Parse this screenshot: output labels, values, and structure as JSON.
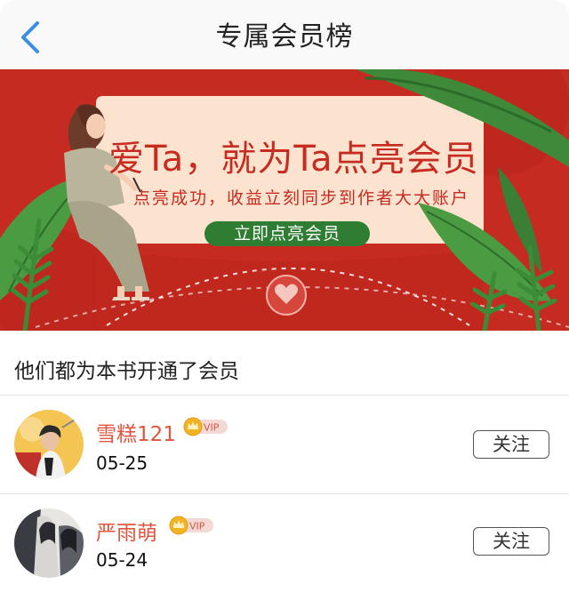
{
  "header": {
    "title": "专属会员榜",
    "back_icon": "chevron-left-icon",
    "accent_color": "#3a8ee6"
  },
  "banner": {
    "headline": "爱Ta，就为Ta点亮会员",
    "subtitle": "点亮成功，收益立刻同步到作者大大账户",
    "cta_label": "立即点亮会员",
    "primary_color": "#c62b21",
    "card_color": "#fbe3cf",
    "cta_color": "#2e7d32"
  },
  "section": {
    "title": "他们都为本书开通了会员"
  },
  "members": [
    {
      "name": "雪糕121",
      "badge": "VIP",
      "date": "05-25",
      "follow_label": "关注"
    },
    {
      "name": "严雨萌",
      "badge": "VIP",
      "date": "05-24",
      "follow_label": "关注"
    }
  ]
}
